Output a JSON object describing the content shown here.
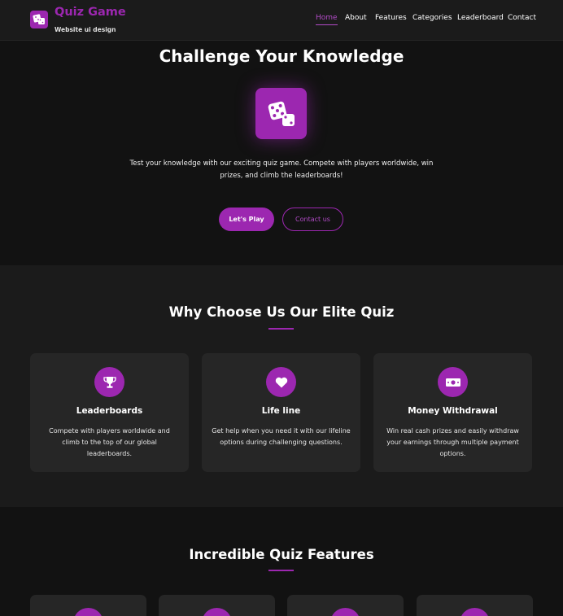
{
  "brand": {
    "title": "Quiz Game",
    "subtitle": "Website ui design",
    "logo_icon": "dice-icon"
  },
  "nav": [
    {
      "label": "Home",
      "active": true
    },
    {
      "label": "About"
    },
    {
      "label": "Features"
    },
    {
      "label": "Categories"
    },
    {
      "label": "Leaderboard"
    },
    {
      "label": "Contact"
    }
  ],
  "hero": {
    "title": "Challenge Your Knowledge",
    "icon": "dice-icon",
    "text": "Test your knowledge with our exciting quiz game. Compete with players worldwide, win prizes, and climb the leaderboards!",
    "play_label": "Let's Play",
    "contact_label": "Contact us"
  },
  "why": {
    "title": "Why Choose Us Our Elite Quiz",
    "cards": [
      {
        "icon": "trophy-icon",
        "title": "Leaderboards",
        "text": "Compete with players worldwide and climb to the top of our global leaderboards."
      },
      {
        "icon": "heart-icon",
        "title": "Life line",
        "text": "Get help when you need it with our lifeline options during challenging questions."
      },
      {
        "icon": "money-icon",
        "title": "Money Withdrawal",
        "text": "Win real cash prizes and easily withdraw your earnings through multiple payment options."
      }
    ]
  },
  "features": {
    "title": "Incredible Quiz Features",
    "cards": [
      {
        "icon": "feature-icon"
      },
      {
        "icon": "feature-icon"
      },
      {
        "icon": "feature-icon"
      },
      {
        "icon": "feature-icon"
      }
    ]
  },
  "colors": {
    "accent": "#9c27b0",
    "background": "#121212",
    "section": "#1b1b1b",
    "card": "#262626"
  }
}
